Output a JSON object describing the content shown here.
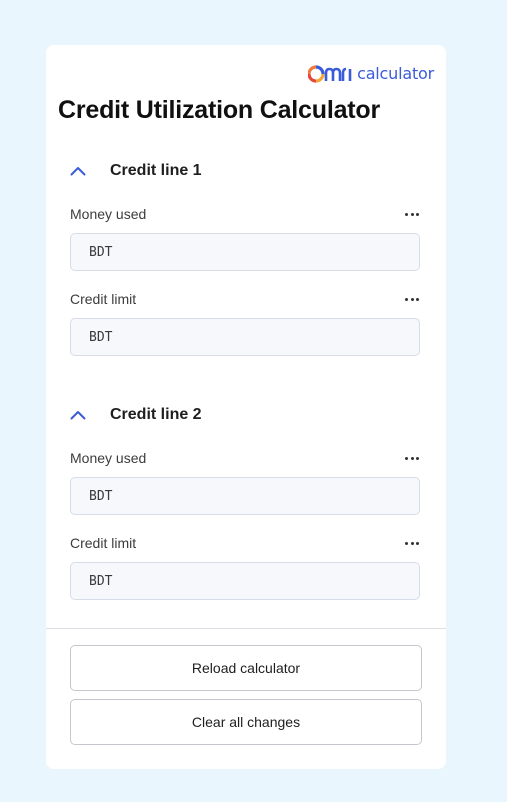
{
  "logo": {
    "brand": "OMNI",
    "product": "calculator"
  },
  "title": "Credit Utilization Calculator",
  "sections": [
    {
      "title": "Credit line 1",
      "fields": [
        {
          "label": "Money used",
          "value": "",
          "placeholder": "BDT"
        },
        {
          "label": "Credit limit",
          "value": "",
          "placeholder": "BDT"
        }
      ]
    },
    {
      "title": "Credit line 2",
      "fields": [
        {
          "label": "Money used",
          "value": "",
          "placeholder": "BDT"
        },
        {
          "label": "Credit limit",
          "value": "",
          "placeholder": "BDT"
        }
      ]
    }
  ],
  "buttons": {
    "reload": "Reload calculator",
    "clear": "Clear all changes"
  },
  "colors": {
    "page_bg": "#eaf6fd",
    "accent": "#3b5bdb",
    "field_bg": "#f6f8fb",
    "field_border": "#d6dde8"
  },
  "icons": {
    "collapse": "chevron-up-icon",
    "options": "more-horizontal-icon"
  }
}
